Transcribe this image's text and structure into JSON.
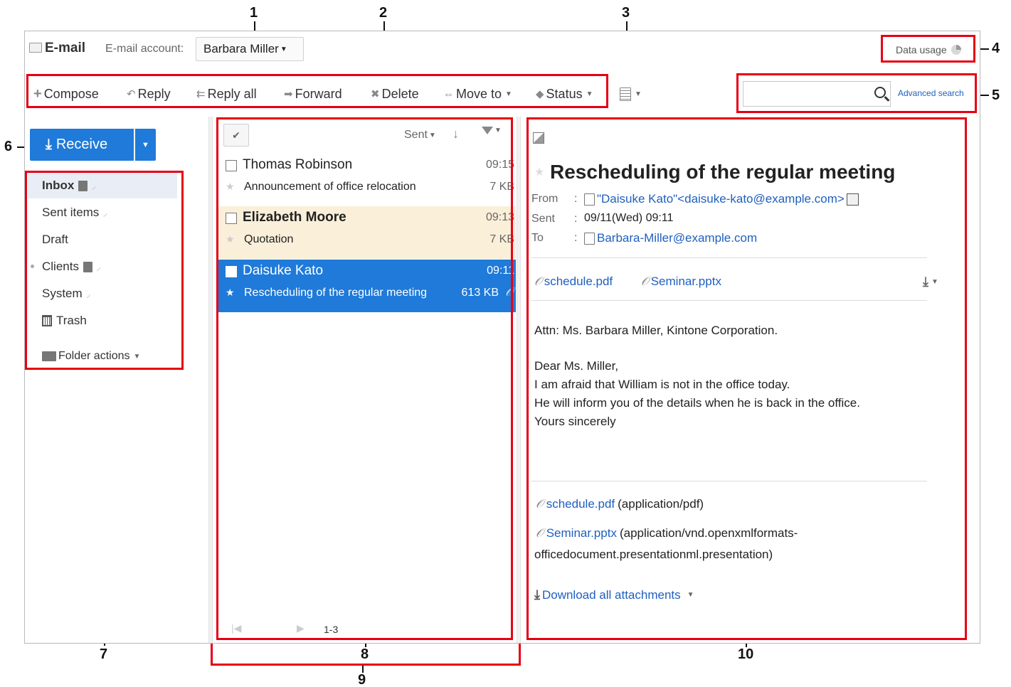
{
  "callouts": [
    "1",
    "2",
    "3",
    "4",
    "5",
    "6",
    "7",
    "8",
    "9",
    "10"
  ],
  "header": {
    "app_title": "E-mail",
    "account_label": "E-mail account:",
    "account_value": "Barbara Miller",
    "data_usage": "Data usage",
    "advanced_search": "Advanced search"
  },
  "toolbar": {
    "compose": "Compose",
    "reply": "Reply",
    "reply_all": "Reply all",
    "forward": "Forward",
    "delete": "Delete",
    "move_to": "Move to",
    "status": "Status"
  },
  "search": {
    "placeholder": ""
  },
  "sidebar": {
    "receive": "Receive",
    "folders": [
      {
        "label": "Inbox"
      },
      {
        "label": "Sent items"
      },
      {
        "label": "Draft"
      },
      {
        "label": "Clients"
      },
      {
        "label": "System"
      },
      {
        "label": "Trash"
      }
    ],
    "folder_actions": "Folder actions"
  },
  "list": {
    "sort_label": "Sent",
    "mails": [
      {
        "sender": "Thomas Robinson",
        "time": "09:15",
        "subject": "Announcement of office relocation",
        "size": "7 KB"
      },
      {
        "sender": "Elizabeth Moore",
        "time": "09:13",
        "subject": "Quotation",
        "size": "7 KB"
      },
      {
        "sender": "Daisuke Kato",
        "time": "09:11",
        "subject": "Rescheduling of the regular meeting",
        "size": "613 KB"
      }
    ],
    "pager": "1-3"
  },
  "mail": {
    "subject": "Rescheduling of the regular meeting",
    "from_label": "From",
    "from_value": "\"Daisuke Kato\"<daisuke-kato@example.com>",
    "sent_label": "Sent",
    "sent_value": "09/11(Wed) 09:11",
    "to_label": "To",
    "to_value": "Barbara-Miller@example.com",
    "attachments": [
      "schedule.pdf",
      "Seminar.pptx"
    ],
    "body": [
      "Attn: Ms. Barbara Miller, Kintone Corporation.",
      "Dear Ms. Miller,",
      "I am afraid that William is not in the office today.",
      "He will inform you of the details when he is back in the office.",
      "Yours sincerely"
    ],
    "attachment_details": [
      {
        "name": "schedule.pdf",
        "type": "(application/pdf)"
      },
      {
        "name": "Seminar.pptx",
        "type": "(application/vnd.openxmlformats-",
        "type2": "officedocument.presentationml.presentation)"
      }
    ],
    "download_all": "Download all attachments"
  },
  "colors": {
    "accent": "#1f7ad9",
    "callout_red": "#e60012",
    "unread_bg": "#faefd9",
    "link": "#1f5fbf"
  }
}
